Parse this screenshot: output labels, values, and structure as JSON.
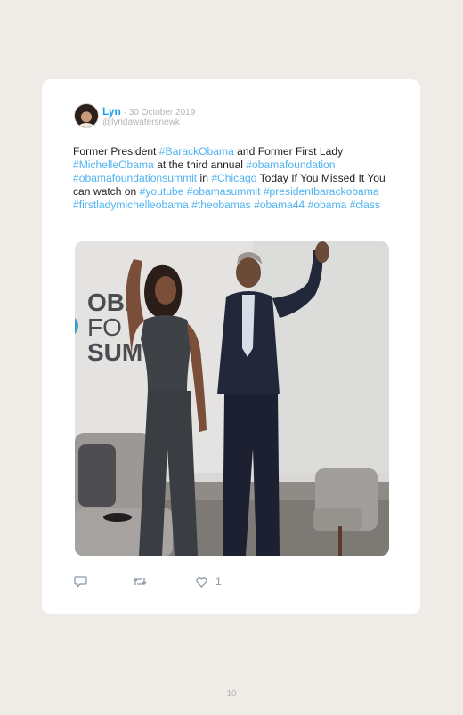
{
  "tweet": {
    "user_name": "Lyn",
    "separator": " · ",
    "date": "30 October 2019",
    "handle": "@lyndawatersnewk",
    "text_parts": [
      {
        "t": "Former President ",
        "tag": false
      },
      {
        "t": "#BarackObama",
        "tag": true
      },
      {
        "t": " and Former First Lady ",
        "tag": false
      },
      {
        "t": "#MichelleObama",
        "tag": true
      },
      {
        "t": " at the third annual ",
        "tag": false
      },
      {
        "t": "#obamafoundation",
        "tag": true
      },
      {
        "t": " ",
        "tag": false
      },
      {
        "t": "#obamafoundationsummit",
        "tag": true
      },
      {
        "t": " in ",
        "tag": false
      },
      {
        "t": "#Chicago",
        "tag": true
      },
      {
        "t": " Today If You Missed It You can watch on ",
        "tag": false
      },
      {
        "t": "#youtube",
        "tag": true
      },
      {
        "t": " ",
        "tag": false
      },
      {
        "t": "#obamasummit",
        "tag": true
      },
      {
        "t": " ",
        "tag": false
      },
      {
        "t": "#presidentbarackobama",
        "tag": true
      },
      {
        "t": " ",
        "tag": false
      },
      {
        "t": "#firstladymichelleobama",
        "tag": true
      },
      {
        "t": " ",
        "tag": false
      },
      {
        "t": "#theobamas",
        "tag": true
      },
      {
        "t": " ",
        "tag": false
      },
      {
        "t": "#obama44",
        "tag": true
      },
      {
        "t": " ",
        "tag": false
      },
      {
        "t": "#obama",
        "tag": true
      },
      {
        "t": " ",
        "tag": false
      },
      {
        "t": "#class",
        "tag": true
      }
    ],
    "photo": {
      "backdrop_line1": "OBA",
      "backdrop_line2": "FO",
      "backdrop_line3": "SUM"
    },
    "actions": {
      "reply_icon": "reply-icon",
      "retweet_icon": "retweet-icon",
      "like_icon": "heart-icon",
      "like_count": "1"
    }
  },
  "page_number": "10",
  "colors": {
    "background": "#efece8",
    "card": "#ffffff",
    "hashtag": "#4fb3f2",
    "name": "#1da1f2",
    "muted": "#b8b3ae",
    "icon": "#8a99a6"
  }
}
